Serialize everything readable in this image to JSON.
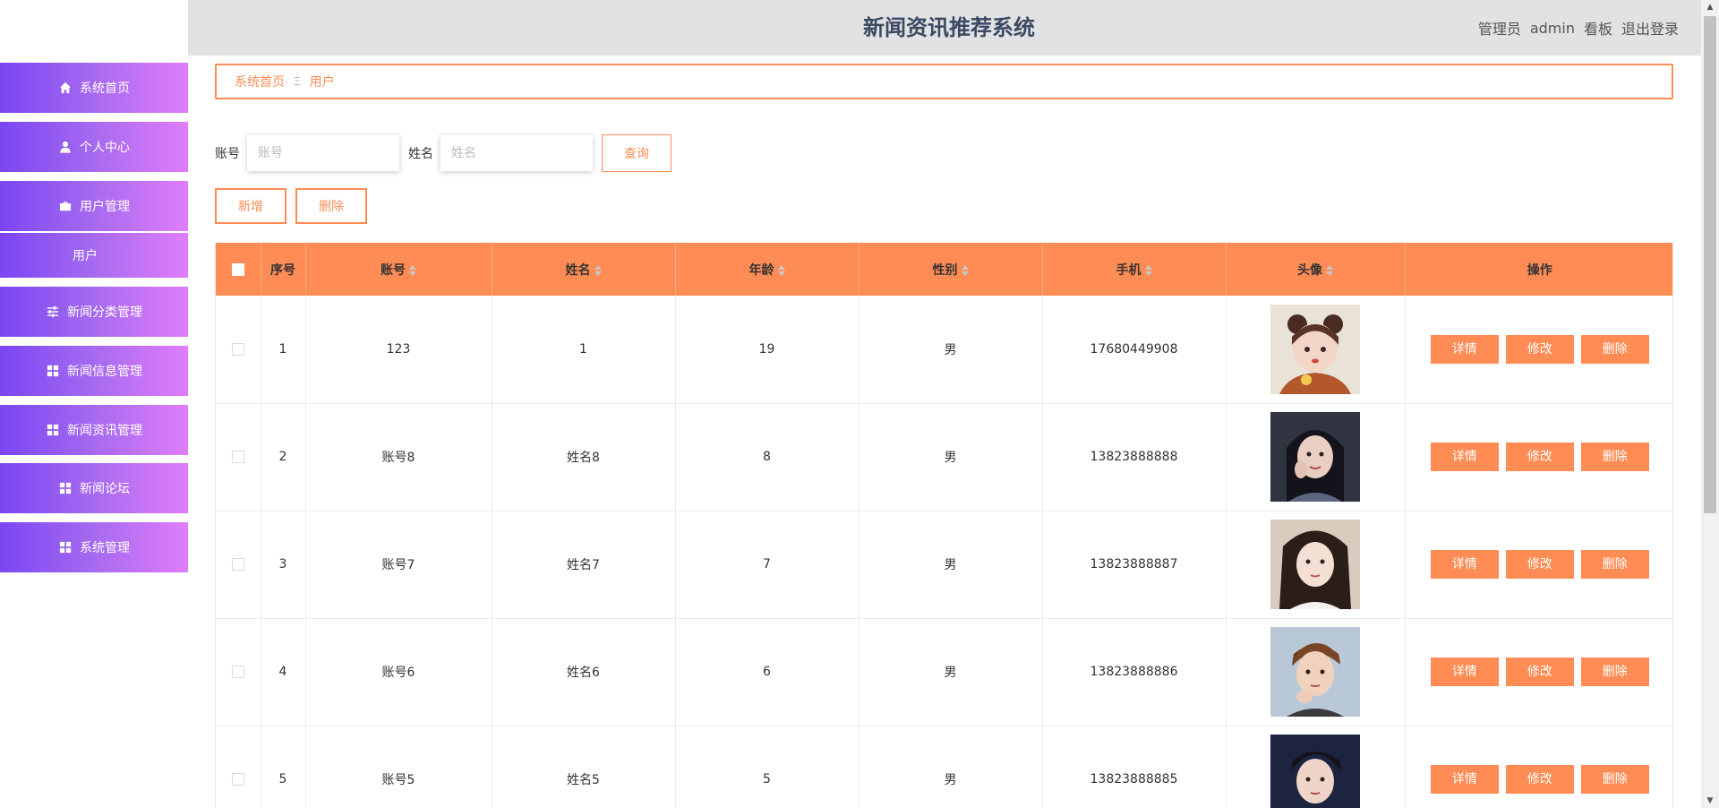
{
  "header": {
    "title": "新闻资讯推荐系统",
    "role": "管理员",
    "username": "admin",
    "dashboard": "看板",
    "logout": "退出登录"
  },
  "sidebar": {
    "items": [
      {
        "label": "系统首页",
        "icon": "home-icon"
      },
      {
        "label": "个人中心",
        "icon": "user-icon"
      },
      {
        "label": "用户管理",
        "icon": "briefcase-icon"
      },
      {
        "label": "新闻分类管理",
        "icon": "sliders-icon"
      },
      {
        "label": "新闻信息管理",
        "icon": "grid-icon"
      },
      {
        "label": "新闻资讯管理",
        "icon": "grid-icon"
      },
      {
        "label": "新闻论坛",
        "icon": "grid-icon"
      },
      {
        "label": "系统管理",
        "icon": "grid-icon"
      }
    ],
    "submenu_item": "用户"
  },
  "breadcrumb": {
    "home": "系统首页",
    "separator": "Ξ",
    "current": "用户"
  },
  "search": {
    "account_label": "账号",
    "account_placeholder": "账号",
    "name_label": "姓名",
    "name_placeholder": "姓名",
    "query_button": "查询"
  },
  "actions": {
    "add": "新增",
    "delete": "删除"
  },
  "table": {
    "headers": [
      "序号",
      "账号",
      "姓名",
      "年龄",
      "性别",
      "手机",
      "头像",
      "操作"
    ],
    "rows": [
      {
        "index": "1",
        "account": "123",
        "name": "1",
        "age": "19",
        "gender": "男",
        "phone": "17680449908"
      },
      {
        "index": "2",
        "account": "账号8",
        "name": "姓名8",
        "age": "8",
        "gender": "男",
        "phone": "13823888888"
      },
      {
        "index": "3",
        "account": "账号7",
        "name": "姓名7",
        "age": "7",
        "gender": "男",
        "phone": "13823888887"
      },
      {
        "index": "4",
        "account": "账号6",
        "name": "姓名6",
        "age": "6",
        "gender": "男",
        "phone": "13823888886"
      },
      {
        "index": "5",
        "account": "账号5",
        "name": "姓名5",
        "age": "5",
        "gender": "男",
        "phone": "13823888885"
      }
    ],
    "row_actions": {
      "detail": "详情",
      "edit": "修改",
      "delete": "删除"
    }
  },
  "colors": {
    "accent": "#ff8c54",
    "sidebar_gradient_start": "#7b46f3",
    "sidebar_gradient_end": "#e07dfa",
    "header_bg": "#e2e1e3",
    "title_color": "#3a4a63"
  }
}
